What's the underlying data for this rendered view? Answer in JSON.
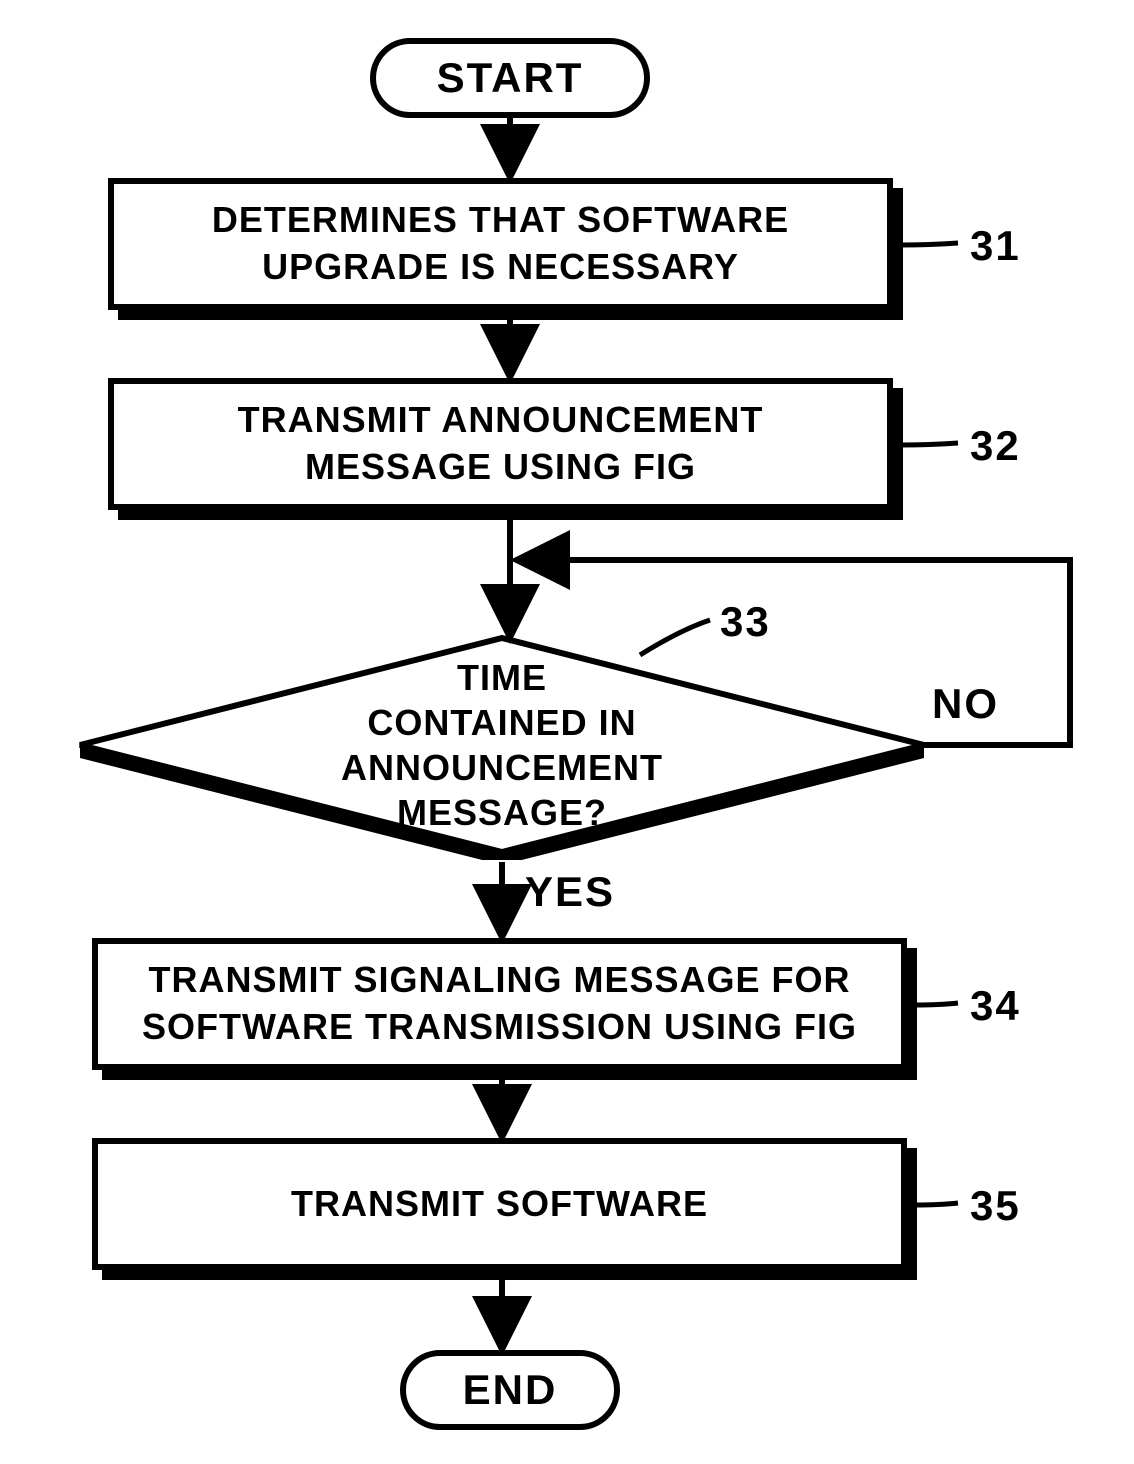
{
  "flowchart": {
    "start": "START",
    "end": "END",
    "steps": {
      "s31": {
        "label": "31",
        "text": "DETERMINES THAT SOFTWARE\nUPGRADE IS NECESSARY"
      },
      "s32": {
        "label": "32",
        "text": "TRANSMIT ANNOUNCEMENT\nMESSAGE USING FIG"
      },
      "s33": {
        "label": "33",
        "text": "TIME\nCONTAINED IN ANNOUNCEMENT\nMESSAGE?"
      },
      "s34": {
        "label": "34",
        "text": "TRANSMIT SIGNALING MESSAGE FOR\nSOFTWARE TRANSMISSION USING FIG"
      },
      "s35": {
        "label": "35",
        "text": "TRANSMIT SOFTWARE"
      }
    },
    "branches": {
      "yes": "YES",
      "no": "NO"
    }
  }
}
